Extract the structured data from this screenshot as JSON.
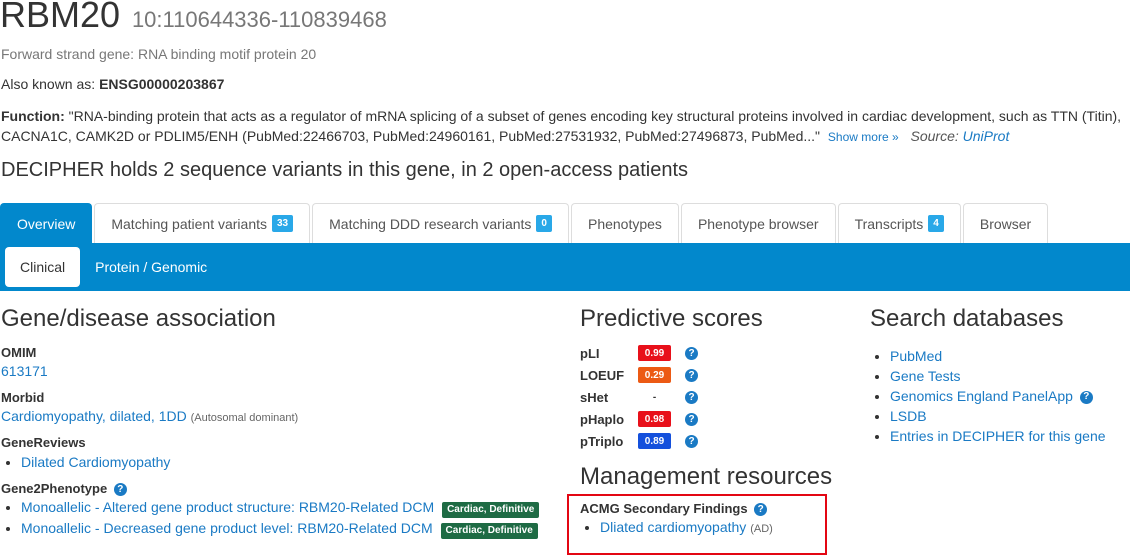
{
  "gene": {
    "symbol": "RBM20",
    "location": "10:110644336-110839468",
    "strand_text": "Forward strand gene: RNA binding motif protein 20",
    "aka_label": "Also known as:",
    "aka_value": "ENSG00000203867",
    "function_label": "Function:",
    "function_text": "\"RNA-binding protein that acts as a regulator of mRNA splicing of a subset of genes encoding key structural proteins involved in cardiac development, such as TTN (Titin), CACNA1C, CAMK2D or PDLIM5/ENH (PubMed:22466703, PubMed:24960161, PubMed:27531932, PubMed:27496873, PubMed...\"",
    "show_more": "Show more »",
    "source_label": "Source:",
    "source_link": "UniProt",
    "holds_text": "DECIPHER holds 2 sequence variants in this gene, in 2 open-access patients"
  },
  "tabs": [
    {
      "label": "Overview",
      "badge": null,
      "active": true
    },
    {
      "label": "Matching patient variants",
      "badge": "33"
    },
    {
      "label": "Matching DDD research variants",
      "badge": "0"
    },
    {
      "label": "Phenotypes",
      "badge": null
    },
    {
      "label": "Phenotype browser",
      "badge": null
    },
    {
      "label": "Transcripts",
      "badge": "4"
    },
    {
      "label": "Browser",
      "badge": null
    }
  ],
  "subtabs": [
    {
      "label": "Clinical",
      "active": true
    },
    {
      "label": "Protein / Genomic"
    }
  ],
  "gene_disease": {
    "title": "Gene/disease association",
    "omim_label": "OMIM",
    "omim_value": "613171",
    "morbid_label": "Morbid",
    "morbid_value": "Cardiomyopathy, dilated, 1DD",
    "morbid_inheritance": "(Autosomal dominant)",
    "genereviews_label": "GeneReviews",
    "genereviews_items": [
      "Dilated Cardiomyopathy"
    ],
    "g2p_label": "Gene2Phenotype",
    "g2p_items": [
      {
        "text": "Monoallelic - Altered gene product structure: RBM20-Related DCM",
        "badge": "Cardiac, Definitive"
      },
      {
        "text": "Monoallelic - Decreased gene product level: RBM20-Related DCM",
        "badge": "Cardiac, Definitive"
      }
    ]
  },
  "predictive": {
    "title": "Predictive scores",
    "scores": [
      {
        "name": "pLI",
        "value": "0.99",
        "color": "#e8101a"
      },
      {
        "name": "LOEUF",
        "value": "0.29",
        "color": "#ec5a14"
      },
      {
        "name": "sHet",
        "value": "-",
        "color": null
      },
      {
        "name": "pHaplo",
        "value": "0.98",
        "color": "#e8101a"
      },
      {
        "name": "pTriplo",
        "value": "0.89",
        "color": "#1450dc"
      }
    ]
  },
  "management": {
    "title": "Management resources",
    "acmg_label": "ACMG Secondary Findings",
    "acmg_items": [
      {
        "text": "Dliated cardiomyopathy",
        "note": "(AD)"
      }
    ]
  },
  "search_db": {
    "title": "Search databases",
    "items": [
      "PubMed",
      "Gene Tests",
      "Genomics England PanelApp",
      "LSDB",
      "Entries in DECIPHER for this gene"
    ]
  },
  "colors": {
    "primary": "#0288cc",
    "link": "#1a7ac4",
    "badge": "#29a8e8",
    "g2p_badge": "#1e6b44",
    "highlight_box": "#e30613"
  }
}
